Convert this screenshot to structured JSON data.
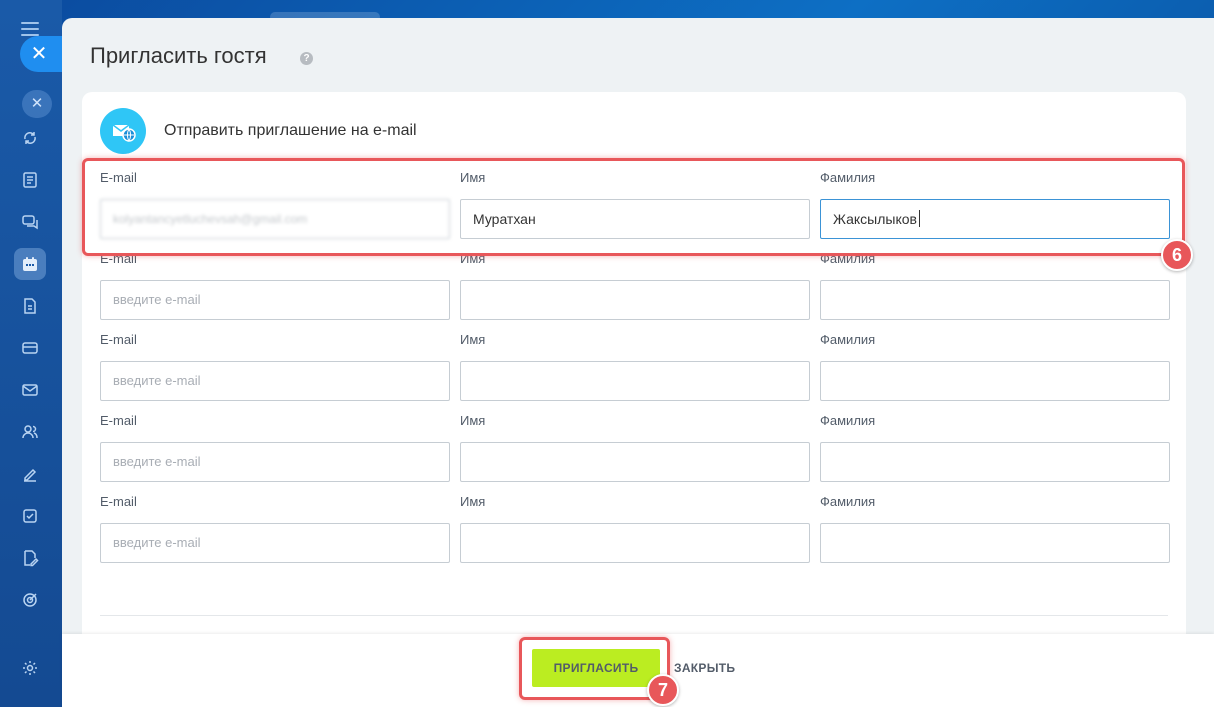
{
  "dialog": {
    "title": "Пригласить гостя",
    "help_glyph": "?",
    "section_heading": "Отправить приглашение на e-mail"
  },
  "labels": {
    "email": "E-mail",
    "first_name": "Имя",
    "last_name": "Фамилия"
  },
  "rows": [
    {
      "email": "kolyantancyetluchevsah@gmail.com",
      "email_placeholder": "введите e-mail",
      "first_name": "Муратхан",
      "last_name": "Жаксылыков"
    },
    {
      "email": "",
      "email_placeholder": "введите e-mail",
      "first_name": "",
      "last_name": ""
    },
    {
      "email": "",
      "email_placeholder": "введите e-mail",
      "first_name": "",
      "last_name": ""
    },
    {
      "email": "",
      "email_placeholder": "введите e-mail",
      "first_name": "",
      "last_name": ""
    },
    {
      "email": "",
      "email_placeholder": "введите e-mail",
      "first_name": "",
      "last_name": ""
    }
  ],
  "footer": {
    "invite_label": "ПРИГЛАСИТЬ",
    "close_label": "ЗАКРЫТЬ"
  },
  "annotations": {
    "step_fields": "6",
    "step_invite": "7"
  },
  "sidebar": {
    "close_glyph": "✕",
    "icons": [
      "sync-icon",
      "news-icon",
      "chat-icon",
      "calendar-icon",
      "document-icon",
      "card-icon",
      "mail-icon",
      "contacts-icon",
      "sign-icon",
      "tasks-icon",
      "edit-doc-icon",
      "goals-icon",
      "settings-icon"
    ]
  },
  "colors": {
    "accent_invite": "#bbed21",
    "highlight": "#e8575a",
    "section_icon": "#2fc6f6"
  }
}
